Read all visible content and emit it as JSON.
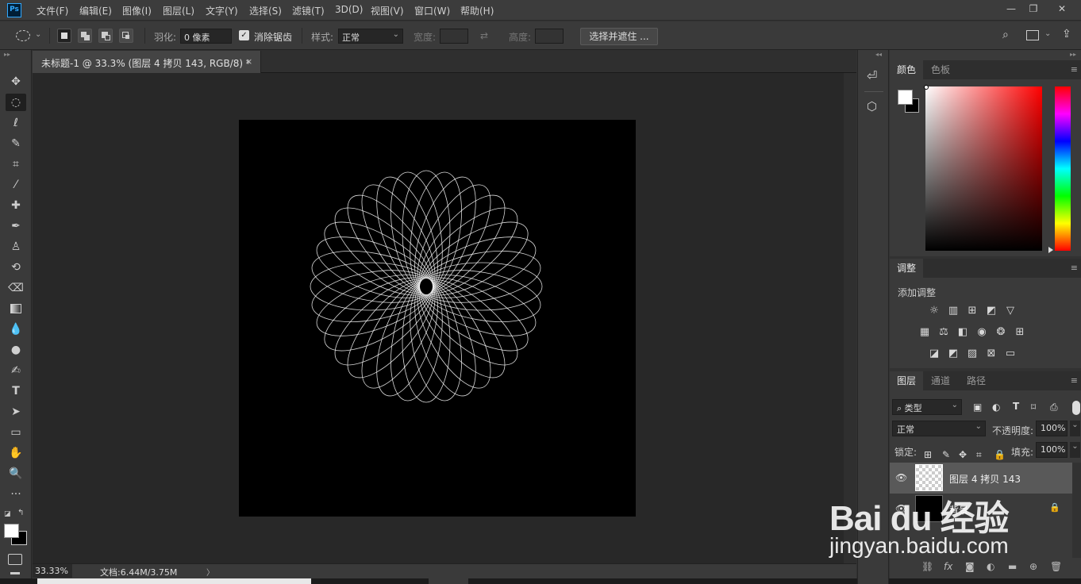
{
  "app": {
    "logo": "Ps"
  },
  "menu": [
    "文件(F)",
    "编辑(E)",
    "图像(I)",
    "图层(L)",
    "文字(Y)",
    "选择(S)",
    "滤镜(T)",
    "3D(D)",
    "视图(V)",
    "窗口(W)",
    "帮助(H)"
  ],
  "options": {
    "feather_label": "羽化:",
    "feather_value": "0 像素",
    "antialias_label": "消除锯齿",
    "style_label": "样式:",
    "style_value": "正常",
    "width_label": "宽度:",
    "height_label": "高度:",
    "select_mask_label": "选择并遮住 ..."
  },
  "document": {
    "tab_title": "未标题-1 @ 33.3% (图层 4 拷贝 143, RGB/8) *",
    "close": "×"
  },
  "status": {
    "zoom": "33.33%",
    "doc_info": "文档:6.44M/3.75M",
    "arrow": "〉"
  },
  "color_panel": {
    "tabs": [
      "颜色",
      "色板"
    ]
  },
  "adjustments_panel": {
    "tab": "调整",
    "add_label": "添加调整"
  },
  "layers_panel": {
    "tabs": [
      "图层",
      "通道",
      "路径"
    ],
    "filter_kind": "类型",
    "blend_mode": "正常",
    "opacity_label": "不透明度:",
    "opacity_value": "100%",
    "lock_label": "锁定:",
    "fill_label": "填充:",
    "fill_value": "100%",
    "layers": [
      {
        "name": "图层 4 拷贝 143",
        "visible": true,
        "selected": true
      },
      {
        "name": "背景",
        "visible": true,
        "locked": true
      }
    ]
  },
  "watermark": {
    "brand": "Bai du 经验",
    "url": "jingyan.baidu.com"
  },
  "colors": {
    "accent": "#31a8ff",
    "panel": "#3a3a3a",
    "canvas_bg": "#282828"
  }
}
